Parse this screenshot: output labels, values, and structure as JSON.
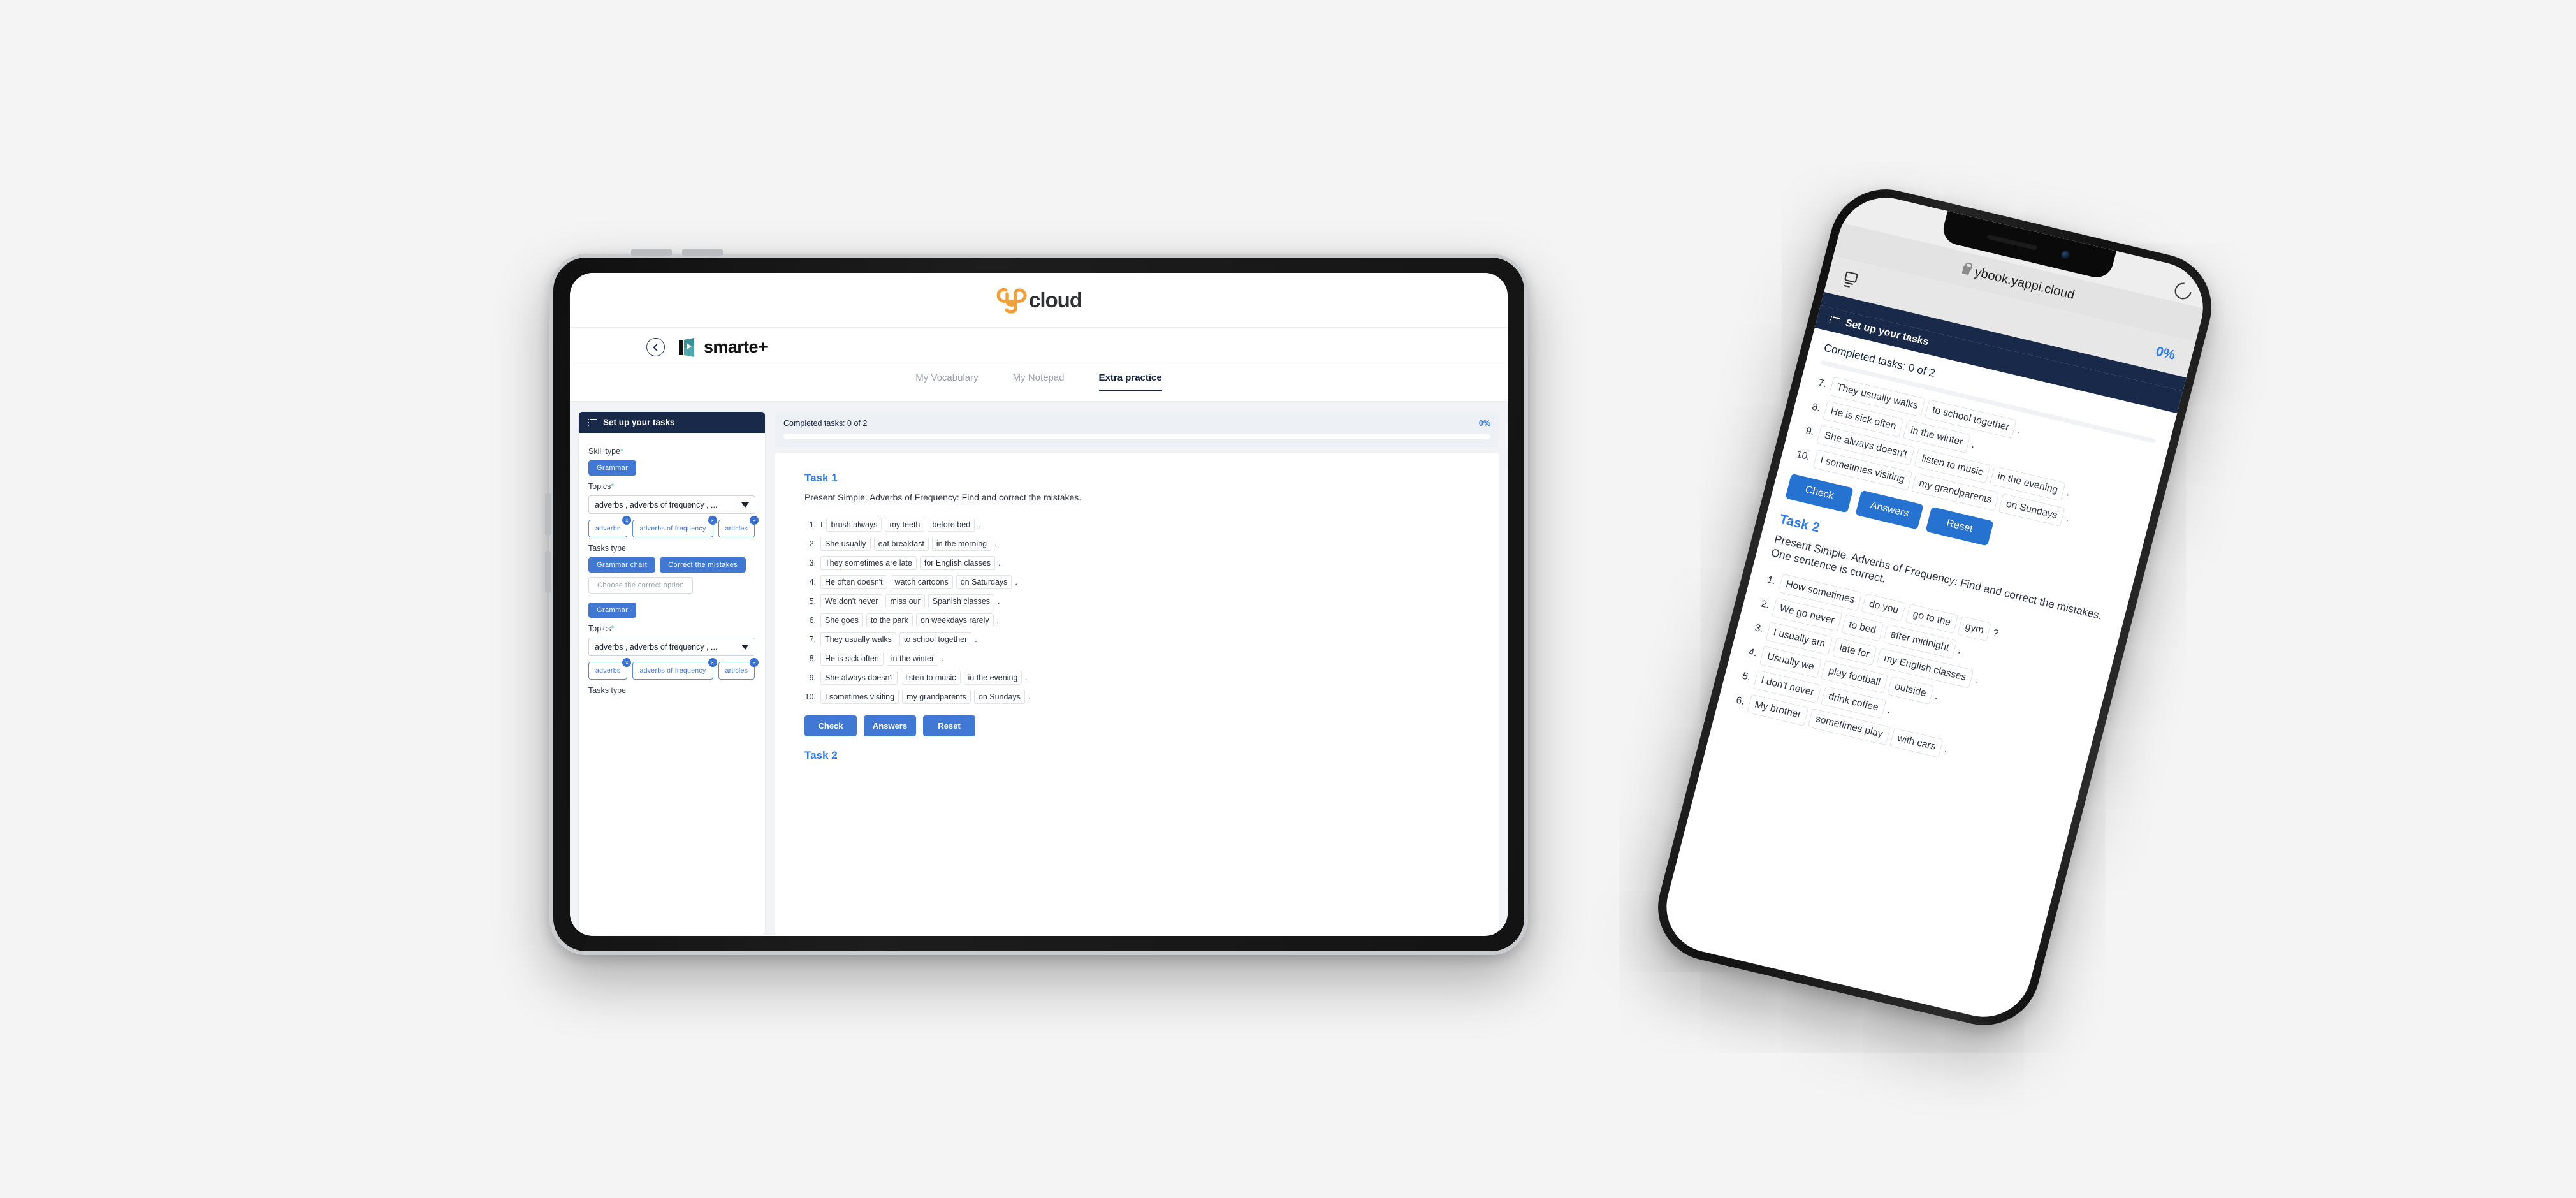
{
  "brand": {
    "logo_text": "cloud",
    "logo_mark": "ycloud-y-icon",
    "accent_orange": "#efa13c",
    "accent_blue": "#4178d4",
    "navy": "#19294a"
  },
  "tablet": {
    "product_logo_text": "smarte+",
    "back_label": "back-icon",
    "tabs": [
      {
        "label": "My Vocabulary",
        "active": false
      },
      {
        "label": "My Notepad",
        "active": false
      },
      {
        "label": "Extra practice",
        "active": true
      }
    ],
    "sidebar": {
      "title": "Set up your tasks",
      "sections": [
        {
          "skill_label": "Skill type",
          "skill_required": "*",
          "skill_value": "Grammar",
          "topics_label": "Topics",
          "topics_required": "*",
          "topics_selected": "adverbs , adverbs of frequency , ...",
          "topic_chips": [
            "adverbs",
            "adverbs of frequency",
            "articles"
          ],
          "tasks_type_label": "Tasks type",
          "task_types": [
            {
              "label": "Grammar chart",
              "selected": true
            },
            {
              "label": "Correct the mistakes",
              "selected": true
            },
            {
              "label": "Choose the correct option",
              "selected": false
            }
          ]
        },
        {
          "skill_value": "Grammar",
          "topics_label": "Topics",
          "topics_required": "*",
          "topics_selected": "adverbs , adverbs of frequency , ...",
          "topic_chips": [
            "adverbs",
            "adverbs of frequency",
            "articles"
          ],
          "tasks_type_label": "Tasks type"
        }
      ],
      "chip_remove_icon": "×"
    },
    "progress": {
      "label": "Completed tasks: 0 of 2",
      "percent_label": "0%",
      "percent_value": 0
    },
    "task1": {
      "title": "Task 1",
      "description": "Present Simple. Adverbs of Frequency: Find and correct the mistakes.",
      "questions": [
        {
          "num": "1.",
          "lead": "I",
          "blanks": [
            "brush always",
            "my teeth",
            "before bed"
          ],
          "end": "."
        },
        {
          "num": "2.",
          "lead": "",
          "blanks": [
            "She usually",
            "eat breakfast",
            "in the morning"
          ],
          "end": "."
        },
        {
          "num": "3.",
          "lead": "",
          "blanks": [
            "They sometimes are late",
            "for English classes"
          ],
          "end": "."
        },
        {
          "num": "4.",
          "lead": "",
          "blanks": [
            "He often doesn't",
            "watch cartoons",
            "on Saturdays"
          ],
          "end": "."
        },
        {
          "num": "5.",
          "lead": "",
          "blanks": [
            "We don't never",
            "miss our",
            "Spanish classes"
          ],
          "end": "."
        },
        {
          "num": "6.",
          "lead": "",
          "blanks": [
            "She goes",
            "to the park",
            "on weekdays rarely"
          ],
          "end": "."
        },
        {
          "num": "7.",
          "lead": "",
          "blanks": [
            "They usually walks",
            "to school together"
          ],
          "end": "."
        },
        {
          "num": "8.",
          "lead": "",
          "blanks": [
            "He is sick often",
            "in the winter"
          ],
          "end": "."
        },
        {
          "num": "9.",
          "lead": "",
          "blanks": [
            "She always doesn't",
            "listen to music",
            "in the evening"
          ],
          "end": "."
        },
        {
          "num": "10.",
          "lead": "",
          "blanks": [
            "I sometimes visiting",
            "my grandparents",
            "on Sundays"
          ],
          "end": "."
        }
      ],
      "buttons": [
        "Check",
        "Answers",
        "Reset"
      ]
    },
    "task2_peek_title": "Task 2"
  },
  "phone": {
    "url": "ybook.yappi.cloud",
    "reload_icon": "reload-icon",
    "lock_icon": "lock-icon",
    "tabs_icon": "tabs-icon",
    "percent_label": "0%",
    "sidebar_title": "Set up your tasks",
    "progress_label": "Completed tasks: 0 of 2",
    "task1_tail": [
      {
        "num": "7.",
        "blanks": [
          "They usually walks",
          "to school together"
        ],
        "end": "."
      },
      {
        "num": "8.",
        "blanks": [
          "He is sick often",
          "in the winter"
        ],
        "end": "."
      },
      {
        "num": "9.",
        "blanks": [
          "She always doesn't",
          "listen to music",
          "in the evening"
        ],
        "end": "."
      },
      {
        "num": "10.",
        "blanks": [
          "I sometimes visiting",
          "my grandparents",
          "on Sundays"
        ],
        "end": "."
      }
    ],
    "buttons": [
      "Check",
      "Answers",
      "Reset"
    ],
    "task2": {
      "title": "Task 2",
      "description": "Present Simple. Adverbs of Frequency: Find and correct the mistakes. One sentence is correct.",
      "questions": [
        {
          "num": "1.",
          "blanks": [
            "How sometimes",
            "do you",
            "go to the",
            "gym"
          ],
          "end": "?"
        },
        {
          "num": "2.",
          "blanks": [
            "We go never",
            "to bed",
            "after midnight"
          ],
          "end": "."
        },
        {
          "num": "3.",
          "blanks": [
            "I usually am",
            "late for",
            "my English classes"
          ],
          "end": "."
        },
        {
          "num": "4.",
          "blanks": [
            "Usually we",
            "play football",
            "outside"
          ],
          "end": "."
        },
        {
          "num": "5.",
          "blanks": [
            "I don't never",
            "drink coffee"
          ],
          "end": "."
        },
        {
          "num": "6.",
          "blanks": [
            "My brother",
            "sometimes play",
            "with cars"
          ],
          "end": "."
        }
      ]
    }
  }
}
